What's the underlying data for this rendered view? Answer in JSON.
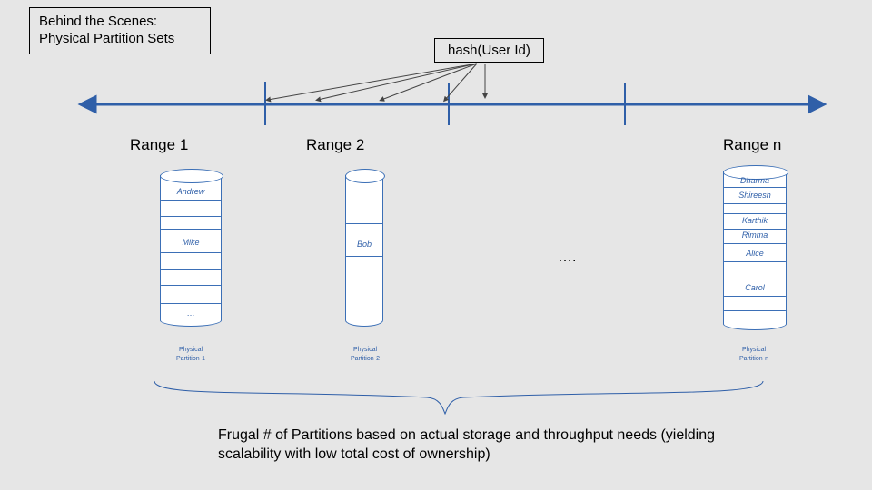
{
  "title": "Behind the Scenes: Physical Partition Sets",
  "hash_label": "hash(User Id)",
  "ranges": {
    "r1": "Range 1",
    "r2": "Range 2",
    "rn": "Range n"
  },
  "cyl1": {
    "andrew": "Andrew",
    "mike": "Mike",
    "dots": "…"
  },
  "cyl2": {
    "bob": "Bob"
  },
  "cylN": {
    "dharma": "Dharma",
    "shireesh": "Shireesh",
    "karthik": "Karthik",
    "rimma": "Rimma",
    "alice": "Alice",
    "carol": "Carol",
    "dots": "…"
  },
  "mid_ellipsis": "…. ",
  "partitions": {
    "p1a": "Physical",
    "p1b": "Partition",
    "p1n": "1",
    "p2a": "Physical",
    "p2b": "Partition",
    "p2n": "2",
    "pna": "Physical",
    "pnb": "Partition",
    "pnn": "n"
  },
  "caption": "Frugal # of Partitions based on actual storage and throughput needs (yielding scalability with low total cost of ownership)"
}
